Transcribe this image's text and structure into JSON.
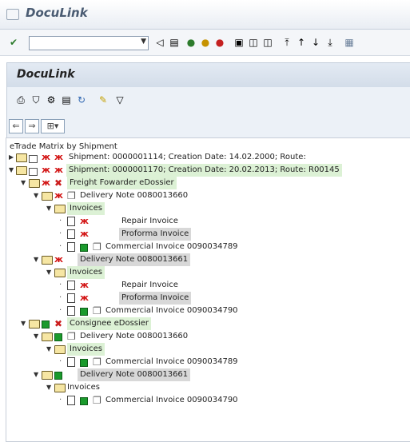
{
  "window": {
    "title": "DocuLink"
  },
  "panel": {
    "title": "DocuLink"
  },
  "tree": {
    "header": "eTrade Matrix by Shipment",
    "rows": [
      {
        "text": "Shipment: 0000001114; Creation Date: 14.02.2000; Route:"
      },
      {
        "text": "Shipment: 0000001170; Creation Date: 20.02.2013; Route: R00145"
      },
      {
        "text": "Freight Fowarder eDossier"
      },
      {
        "text": "Delivery Note 0080013660"
      },
      {
        "text": "Invoices"
      },
      {
        "text": "Repair Invoice"
      },
      {
        "text": "Proforma Invoice"
      },
      {
        "text": "Commercial Invoice  0090034789"
      },
      {
        "text": "Delivery Note 0080013661"
      },
      {
        "text": "Invoices"
      },
      {
        "text": "Repair Invoice"
      },
      {
        "text": "Proforma Invoice"
      },
      {
        "text": "Commercial Invoice  0090034790"
      },
      {
        "text": "Consignee eDossier"
      },
      {
        "text": "Delivery Note 0080013660"
      },
      {
        "text": "Invoices"
      },
      {
        "text": "Commercial Invoice  0090034789"
      },
      {
        "text": "Delivery Note 0080013661"
      },
      {
        "text": "Invoices"
      },
      {
        "text": "Commercial Invoice  0090034790"
      }
    ]
  },
  "icons": {
    "check": "check-icon",
    "nav_back": "arrow-left-icon",
    "nav_forward": "arrow-right-icon",
    "folder": "folder-icon",
    "lock": "lock-icon",
    "document": "document-icon",
    "error": "error-bug-icon",
    "success": "green-status-icon",
    "cross": "red-cross-icon",
    "delivery": "delivery-note-icon"
  },
  "colors": {
    "highlight_green": "#dcf1d5",
    "highlight_gray": "#d8d8d8",
    "status_green": "#1a9a2c",
    "status_red": "#d21010"
  }
}
